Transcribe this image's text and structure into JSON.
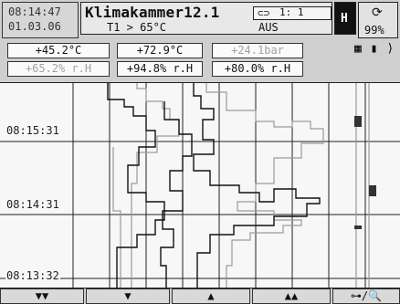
{
  "header": {
    "time": "08:14:47",
    "date": "01.03.06",
    "title": "Klimakammer12.1",
    "key": "1: 1",
    "subtitle": "T1 > 65°C",
    "alarm": "AUS",
    "h_label": "H",
    "battery_icon": "sync-icon",
    "battery_percent": "99%"
  },
  "values": {
    "row1": [
      "+45.2°C",
      "+72.9°C",
      "+24.1bar"
    ],
    "row2": [
      "+65.2% r.H",
      "+94.8% r.H",
      "+80.0% r.H"
    ]
  },
  "mode_icons": [
    "grid-icon",
    "bar-icon",
    "wave-icon"
  ],
  "chart": {
    "times": [
      "08:15:31",
      "08:14:31",
      "08:13:32"
    ]
  },
  "bottom": {
    "page_down_fast": "▼▼",
    "page_down": "▼",
    "page_up": "▲",
    "page_up_fast": "▲▲",
    "search": "⊶/🔍"
  },
  "colors": {
    "trace_dark": "#111111",
    "trace_grey": "#9a9a9a",
    "alarm_block": "#333333"
  }
}
